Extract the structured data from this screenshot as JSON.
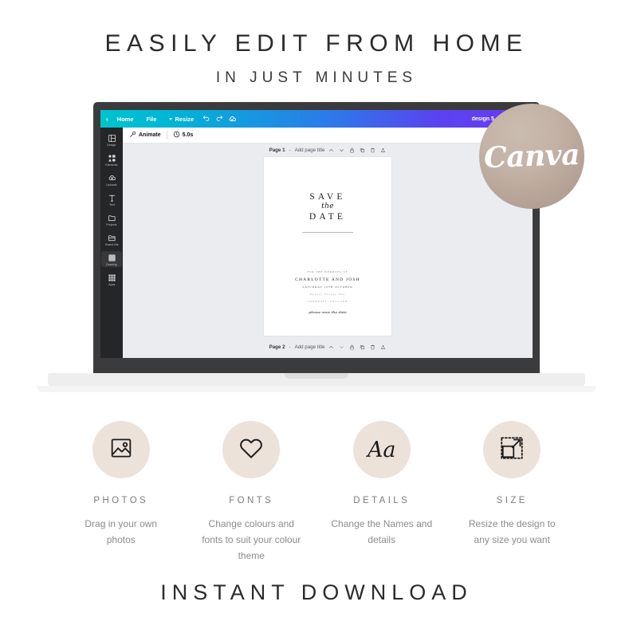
{
  "headline": {
    "line1": "EASILY EDIT FROM HOME",
    "line2": "IN JUST MINUTES"
  },
  "footer": {
    "text": "INSTANT DOWNLOAD"
  },
  "badge": {
    "label": "Canva",
    "color": "#c3b2a5"
  },
  "canva": {
    "topbar": {
      "back_icon": "chevron-left-icon",
      "home": "Home",
      "file": "File",
      "resize": "Resize",
      "undo_icon": "undo-icon",
      "redo_icon": "redo-icon",
      "cloud_icon": "cloud-saved-icon",
      "design_title": "design 5 save the da",
      "gradient_start": "#00c4cc",
      "gradient_end": "#6a3bf0"
    },
    "subbar": {
      "animate_label": "Animate",
      "animate_icon": "magic-wand-icon",
      "timer_icon": "clock-icon",
      "duration": "5.0s"
    },
    "sidebar": [
      {
        "label": "Design",
        "icon": "design-icon",
        "active": false
      },
      {
        "label": "Elements",
        "icon": "elements-icon",
        "active": false
      },
      {
        "label": "Uploads",
        "icon": "uploads-cloud-icon",
        "active": false
      },
      {
        "label": "Text",
        "icon": "text-icon",
        "active": false
      },
      {
        "label": "Projects",
        "icon": "folder-icon",
        "active": false
      },
      {
        "label": "Brand kits",
        "icon": "brandkit-folder-icon",
        "active": false
      },
      {
        "label": "Drawing",
        "icon": "drawing-square-icon",
        "active": true
      },
      {
        "label": "Apps",
        "icon": "apps-grid-icon",
        "active": false
      }
    ],
    "pages": {
      "page1": {
        "label": "Page 1",
        "separator": "-",
        "title_placeholder": "Add page title"
      },
      "page2": {
        "label": "Page 2",
        "separator": "-",
        "title_placeholder": "Add page title"
      },
      "icons": [
        "chevron-up-icon",
        "chevron-down-icon",
        "lock-icon",
        "duplicate-icon",
        "trash-icon",
        "export-icon"
      ]
    },
    "refresh_icon": "refresh-icon"
  },
  "card": {
    "save": "SAVE",
    "the": "the",
    "date": "DATE",
    "for_the_wedding_of": "FOR THE WEDDING OF",
    "names": "CHARLOTTE AND JOSH",
    "date_line": "SATURDAY 16TH OCTOBER",
    "year": "Twenty Twenty Two",
    "place": "CORNWALL, ENGLAND",
    "signature": "please save the date"
  },
  "features": [
    {
      "icon": "photo-image-icon",
      "title": "PHOTOS",
      "desc": "Drag in your own photos"
    },
    {
      "icon": "heart-icon",
      "title": "FONTS",
      "desc": "Change colours and fonts to suit your colour theme"
    },
    {
      "icon": "aa-type-icon",
      "title": "DETAILS",
      "desc": "Change the Names and details"
    },
    {
      "icon": "resize-arrow-icon",
      "title": "SIZE",
      "desc": "Resize the design to any size you want"
    }
  ]
}
